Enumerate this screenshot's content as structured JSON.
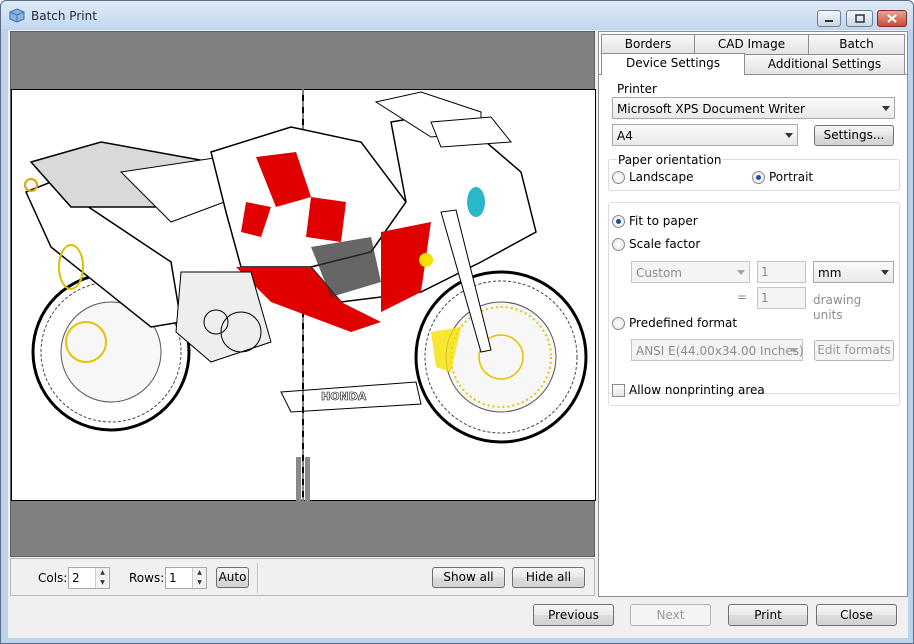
{
  "window": {
    "title": "Batch Print"
  },
  "preview": {
    "cols_label": "Cols:",
    "cols_value": "2",
    "rows_label": "Rows:",
    "rows_value": "1",
    "auto_button": "Auto",
    "show_all_button": "Show all",
    "hide_all_button": "Hide all",
    "drawing_text": "HONDA"
  },
  "tabs": {
    "row1": [
      "Borders",
      "CAD Image",
      "Batch"
    ],
    "row2": [
      "Device Settings",
      "Additional Settings"
    ],
    "active": "Device Settings"
  },
  "device_settings": {
    "printer_label": "Printer",
    "printer_value": "Microsoft XPS Document Writer",
    "paper_value": "A4",
    "settings_button": "Settings...",
    "orientation_label": "Paper orientation",
    "landscape_label": "Landscape",
    "portrait_label": "Portrait",
    "orientation_selected": "Portrait",
    "fit_to_paper_label": "Fit to paper",
    "scale_factor_label": "Scale factor",
    "scale_selected": "Fit to paper",
    "scale_preset_value": "Custom",
    "scale_value_1": "1",
    "units_value": "mm",
    "equals_sign": "=",
    "scale_value_2": "1",
    "drawing_units_label_1": "drawing",
    "drawing_units_label_2": "units",
    "predefined_format_label": "Predefined format",
    "predefined_format_value": "ANSI E(44.00x34.00 Inches)",
    "edit_formats_button": "Edit formats",
    "allow_nonprinting_label": "Allow nonprinting area",
    "allow_nonprinting_checked": false
  },
  "footer": {
    "previous_button": "Previous",
    "next_button": "Next",
    "print_button": "Print",
    "close_button": "Close"
  }
}
